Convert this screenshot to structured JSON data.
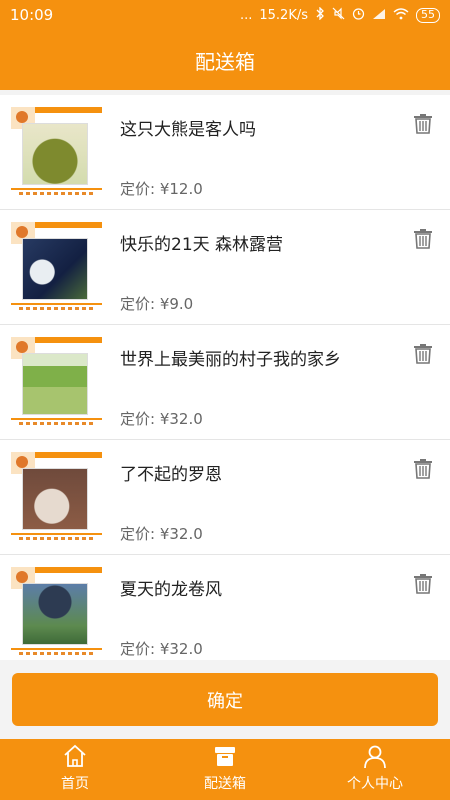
{
  "status_bar": {
    "time": "10:09",
    "dots": "...",
    "speed": "15.2K/s",
    "battery": "55",
    "icons": [
      "bluetooth-icon",
      "mute-icon",
      "alarm-icon",
      "signal-icon",
      "wifi-icon",
      "battery-icon"
    ]
  },
  "header": {
    "title": "配送箱"
  },
  "items": [
    {
      "title": "这只大熊是客人吗",
      "price": "定价: ¥12.0"
    },
    {
      "title": "快乐的21天 森林露营",
      "price": "定价: ¥9.0"
    },
    {
      "title": "世界上最美丽的村子我的家乡",
      "price": "定价: ¥32.0"
    },
    {
      "title": "了不起的罗恩",
      "price": "定价: ¥32.0"
    },
    {
      "title": "夏天的龙卷风",
      "price": "定价: ¥32.0"
    }
  ],
  "actions": {
    "confirm_label": "确定"
  },
  "tabs": [
    {
      "label": "首页",
      "icon": "home-icon"
    },
    {
      "label": "配送箱",
      "icon": "delivery-box-icon"
    },
    {
      "label": "个人中心",
      "icon": "person-icon"
    }
  ],
  "colors": {
    "accent": "#f5910f",
    "background": "#f3f3f3",
    "divider": "#e5e5e5"
  }
}
